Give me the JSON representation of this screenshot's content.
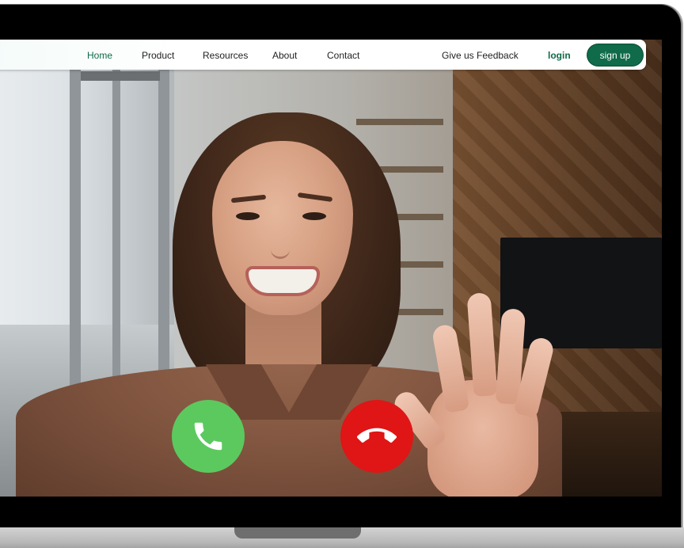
{
  "nav": {
    "items": [
      {
        "label": "Home",
        "active": true
      },
      {
        "label": "Product",
        "active": false
      },
      {
        "label": "Resources",
        "active": false
      },
      {
        "label": "About",
        "active": false
      },
      {
        "label": "Contact",
        "active": false
      }
    ],
    "feedback": "Give us Feedback",
    "login": "login",
    "signup": "sign up"
  },
  "call": {
    "accept_icon": "phone-icon",
    "decline_icon": "phone-hangup-icon",
    "accept_color": "#5cc95f",
    "decline_color": "#e01515"
  },
  "colors": {
    "brand": "#0f6b49"
  }
}
